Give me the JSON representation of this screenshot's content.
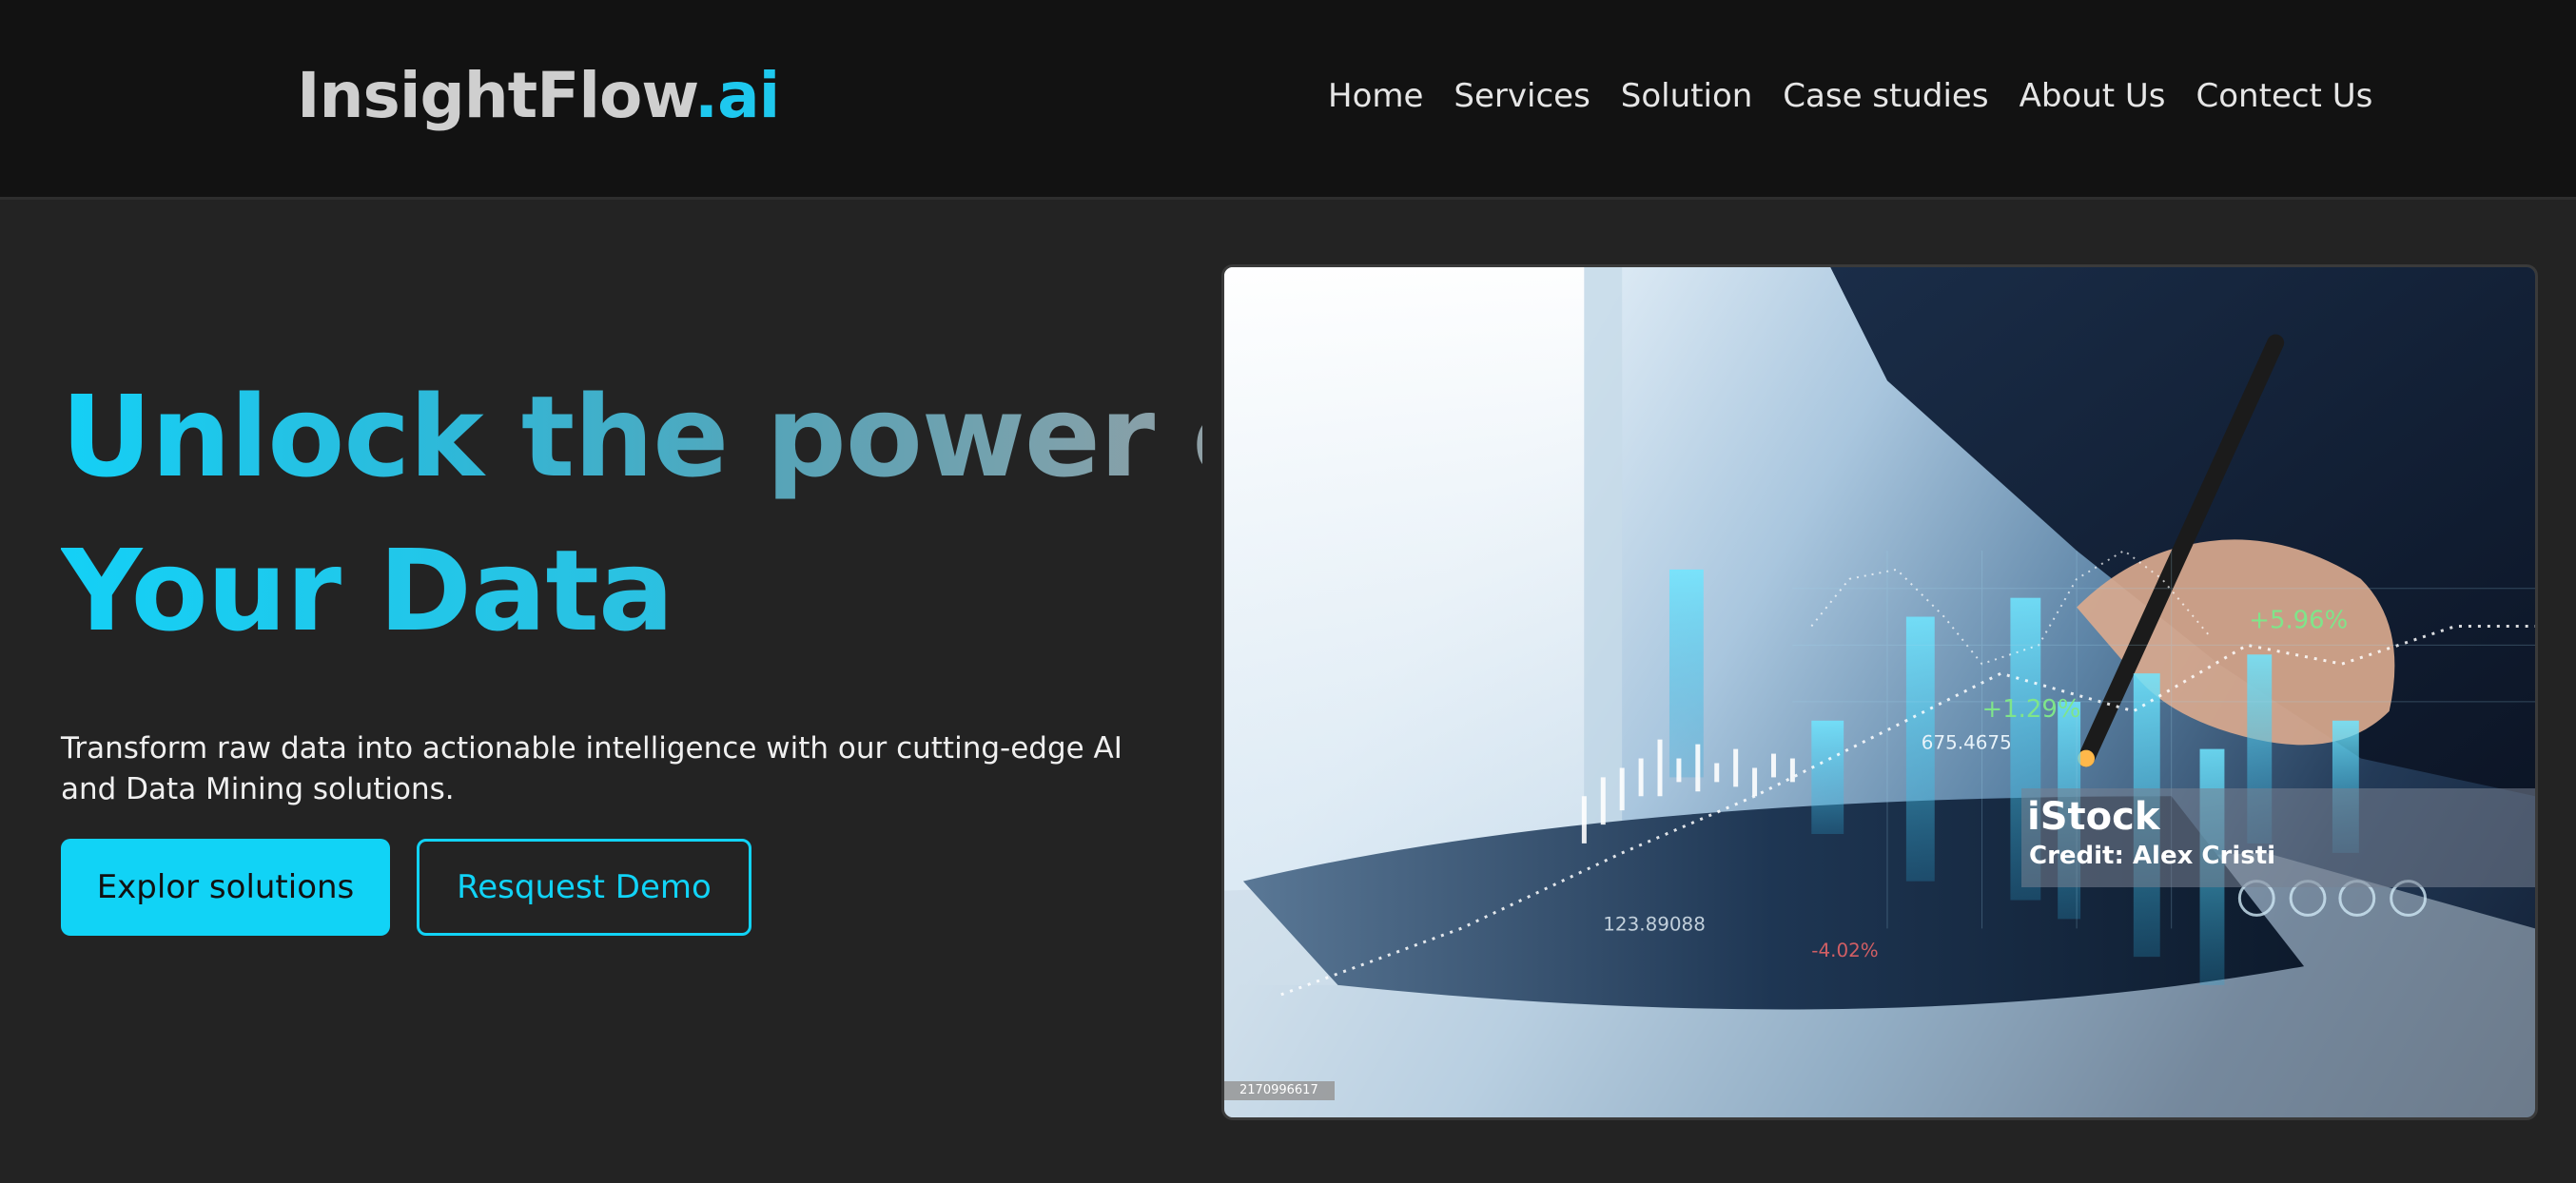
{
  "header": {
    "logo_main": "InsightFlow",
    "logo_accent": ".ai",
    "nav": [
      {
        "label": "Home"
      },
      {
        "label": "Services"
      },
      {
        "label": "Solution"
      },
      {
        "label": "Case studies"
      },
      {
        "label": "About Us"
      },
      {
        "label": "Contect Us"
      }
    ]
  },
  "hero": {
    "title_line1": "Unlock the power of",
    "title_line2": "Your Data",
    "description": "Transform raw data into actionable intelligence with our cutting-edge AI and Data Mining solutions.",
    "primary_button": "Explor solutions",
    "secondary_button": "Resquest Demo"
  },
  "image": {
    "watermark_brand": "iStock",
    "watermark_credit": "Credit: Alex Cristi",
    "image_id": "2170996617",
    "overlay_labels": [
      "+5.96%",
      "+1.29%",
      "675.4675",
      "123.89088",
      "-4.02%"
    ]
  },
  "colors": {
    "accent": "#11d3f6",
    "background": "#232323",
    "header_background": "#121212"
  }
}
